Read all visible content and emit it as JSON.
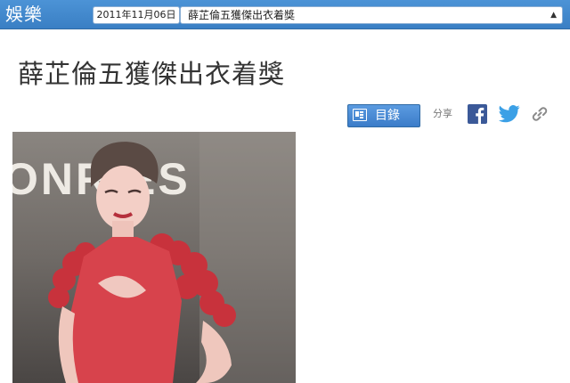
{
  "header": {
    "section_label": "娛樂",
    "date": "2011年11月06日",
    "article_select_value": "薛芷倫五獲傑出衣着獎"
  },
  "article": {
    "title": "薛芷倫五獲傑出衣着獎",
    "photo_backdrop_text": "ONRIES"
  },
  "toolbar": {
    "toc_label": "目錄",
    "share_label": "分享",
    "icons": [
      "table-of-contents-icon",
      "facebook-icon",
      "twitter-icon",
      "link-icon"
    ]
  },
  "colors": {
    "topbar": "#4086cc",
    "toc_button": "#4a8cd6",
    "facebook": "#3b5998",
    "twitter": "#3ba0e6",
    "link": "#8a8a8a",
    "title": "#333333"
  }
}
